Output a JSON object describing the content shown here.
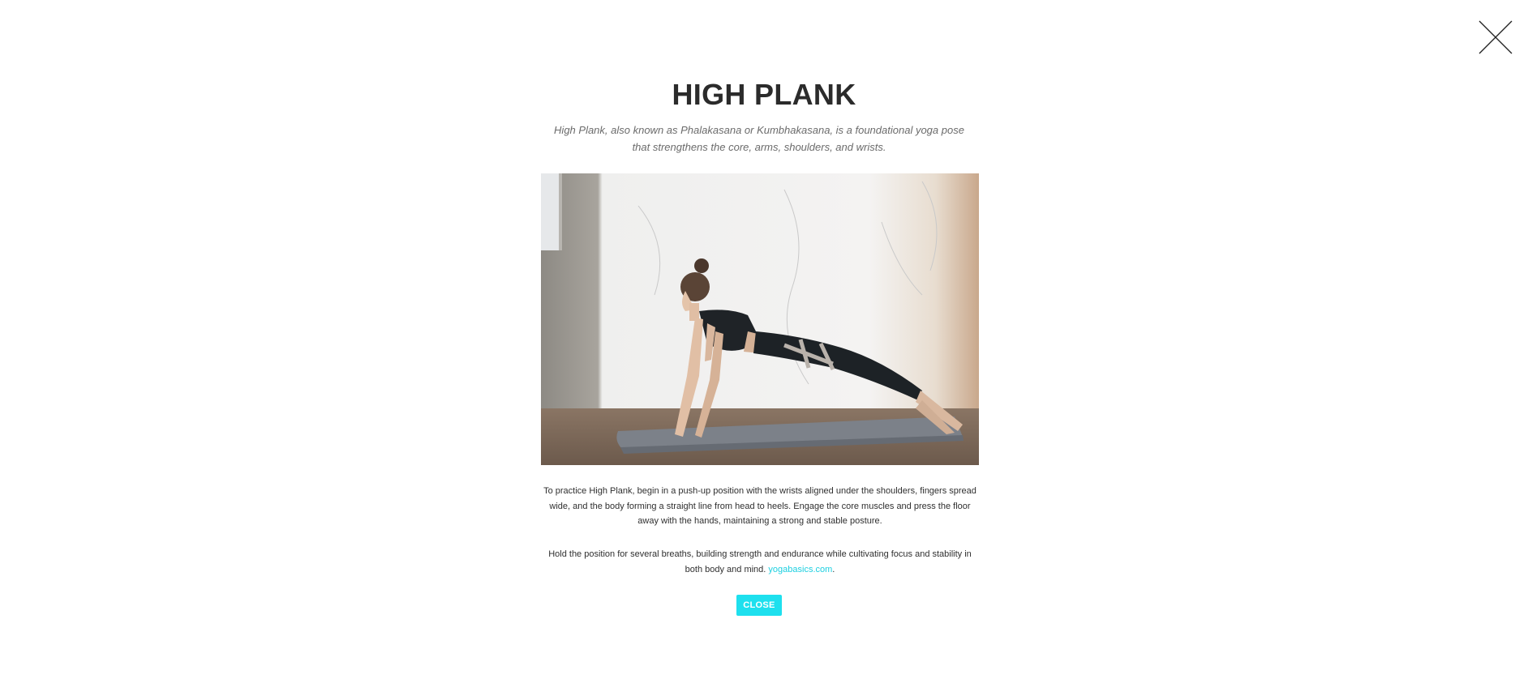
{
  "modal": {
    "title": "HIGH PLANK",
    "subtitle": "High Plank, also known as Phalakasana or Kumbhakasana, is a foundational yoga pose that strengthens the core, arms, shoulders, and wrists.",
    "image_icon": "yoga-high-plank-photo",
    "paragraph1": "To practice High Plank, begin in a push-up position with the wrists aligned under the shoulders, fingers spread wide, and the body forming a straight line from head to heels. Engage the core muscles and press the floor away with the hands, maintaining a strong and stable posture.",
    "paragraph2_text": "Hold the position for several breaths, building strength and endurance while cultivating focus and stability in both body and mind.",
    "paragraph2_link": "yogabasics.com",
    "paragraph2_end": ".",
    "close_button": "CLOSE",
    "close_icon": "close-icon"
  },
  "colors": {
    "accent": "#1ee0ee",
    "link": "#1ccfe0",
    "title": "#2b2b2b"
  }
}
